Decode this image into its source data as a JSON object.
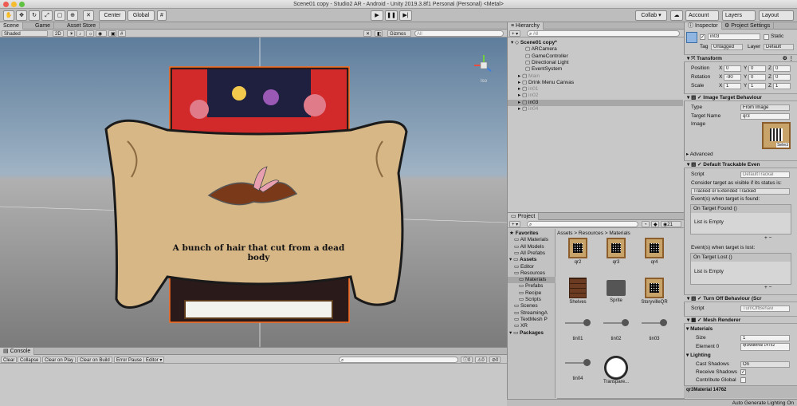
{
  "window_title": "Scene01 copy - Studio2 AR - Android - Unity 2019.3.8f1 Personal (Personal) <Metal>",
  "toolbar": {
    "center": "Center",
    "global": "Global",
    "collab": "Collab ▾",
    "account": "Account",
    "layers": "Layers",
    "layout": "Layout",
    "play_icon": "play-icon",
    "pause_icon": "pause-icon",
    "step_icon": "step-icon"
  },
  "scene": {
    "tabs": [
      "Scene",
      "Game",
      "Asset Store"
    ],
    "shading": "Shaded",
    "mode_2d": "2D",
    "gizmos": "Gizmos",
    "search_placeholder": "All",
    "persp": "Iso",
    "overlay_text": "A bunch of hair that cut from a dead body"
  },
  "console": {
    "tab": "Console",
    "buttons": [
      "Clear",
      "Collapse",
      "Clear on Play",
      "Clear on Build",
      "Error Pause",
      "Editor"
    ],
    "counts": [
      "0",
      "0",
      "0"
    ]
  },
  "hierarchy": {
    "tab": "Hierarchy",
    "add": "+",
    "search_placeholder": "All",
    "items": [
      {
        "label": "Scene01 copy*",
        "indent": 0,
        "dim": false,
        "bold": true
      },
      {
        "label": "ARCamera",
        "indent": 2,
        "dim": false
      },
      {
        "label": "GameController",
        "indent": 2,
        "dim": false
      },
      {
        "label": "Directional Light",
        "indent": 2,
        "dim": false
      },
      {
        "label": "EventSystem",
        "indent": 2,
        "dim": false
      },
      {
        "label": "Main",
        "indent": 1,
        "dim": true
      },
      {
        "label": "Drink Menu Canvas",
        "indent": 1,
        "dim": false
      },
      {
        "label": "in01",
        "indent": 1,
        "dim": true
      },
      {
        "label": "in02",
        "indent": 1,
        "dim": true
      },
      {
        "label": "in03",
        "indent": 1,
        "dim": false,
        "selected": true
      },
      {
        "label": "in04",
        "indent": 1,
        "dim": true
      }
    ]
  },
  "project": {
    "tab": "Project",
    "count": "21",
    "breadcrumb": "Assets > Resources > Materials",
    "tree": [
      {
        "label": "Favorites",
        "indent": 0,
        "bold": true
      },
      {
        "label": "All Materials",
        "indent": 1
      },
      {
        "label": "All Models",
        "indent": 1
      },
      {
        "label": "All Prefabs",
        "indent": 1
      },
      {
        "label": "Assets",
        "indent": 0,
        "bold": true
      },
      {
        "label": "Editor",
        "indent": 1
      },
      {
        "label": "Resources",
        "indent": 1
      },
      {
        "label": "Materials",
        "indent": 2,
        "selected": true
      },
      {
        "label": "Prefabs",
        "indent": 2
      },
      {
        "label": "Recipe",
        "indent": 2
      },
      {
        "label": "Scripts",
        "indent": 2
      },
      {
        "label": "Scenes",
        "indent": 1
      },
      {
        "label": "StreamingA",
        "indent": 1
      },
      {
        "label": "TextMesh P",
        "indent": 1
      },
      {
        "label": "XR",
        "indent": 1
      },
      {
        "label": "Packages",
        "indent": 0,
        "bold": true
      }
    ],
    "assets": [
      {
        "label": "qr2",
        "kind": "qr"
      },
      {
        "label": "qr3",
        "kind": "qr"
      },
      {
        "label": "qr4",
        "kind": "qr"
      },
      {
        "label": "Shelves",
        "kind": "shelves"
      },
      {
        "label": "Sprite",
        "kind": "folder"
      },
      {
        "label": "StoryvilleQR",
        "kind": "qr"
      },
      {
        "label": "tin01",
        "kind": "audio"
      },
      {
        "label": "tin02",
        "kind": "audio"
      },
      {
        "label": "tin03",
        "kind": "audio"
      },
      {
        "label": "tin04",
        "kind": "audio"
      },
      {
        "label": "Transpare...",
        "kind": "white"
      }
    ]
  },
  "inspector": {
    "tabs": [
      "Inspector",
      "Project Settings"
    ],
    "object_name": "in03",
    "static": "Static",
    "tag_label": "Tag",
    "tag": "Untagged",
    "layer_label": "Layer",
    "layer": "Default",
    "transform": {
      "title": "Transform",
      "rows": [
        {
          "label": "Position",
          "x": "0",
          "y": "0",
          "z": "0"
        },
        {
          "label": "Rotation",
          "x": "-90",
          "y": "0",
          "z": "0"
        },
        {
          "label": "Scale",
          "x": "1",
          "y": "1",
          "z": "1"
        }
      ]
    },
    "image_target": {
      "title": "Image Target Behaviour",
      "type_label": "Type",
      "type": "From Image",
      "name_label": "Target Name",
      "name": "qr3",
      "image_label": "Image",
      "select": "Select",
      "advanced": "Advanced"
    },
    "trackable": {
      "title": "Default Trackable Even",
      "script_label": "Script",
      "script": "DefaultTrackal",
      "consider": "Consider target as visible if its status is:",
      "status": "Tracked or Extended Tracked",
      "found_label": "Event(s) when target is found:",
      "found_event": "On Target Found ()",
      "found_empty": "List is Empty",
      "lost_label": "Event(s) when target is lost:",
      "lost_event": "On Target Lost ()",
      "lost_empty": "List is Empty"
    },
    "turnoff": {
      "title": "Turn Off Behaviour (Scr",
      "script_label": "Script",
      "script": "TurnOffBehavi"
    },
    "mesh_renderer": {
      "title": "Mesh Renderer",
      "materials": "Materials",
      "size_label": "Size",
      "size": "1",
      "element_label": "Element 0",
      "element": "qr3Material 14762",
      "lighting": "Lighting",
      "cast_label": "Cast Shadows",
      "cast": "On",
      "receive_label": "Receive Shadows",
      "contribute_label": "Contribute Global",
      "bottom_material": "qr3Material 14762"
    }
  },
  "status_bar": "Auto Generate Lighting On"
}
